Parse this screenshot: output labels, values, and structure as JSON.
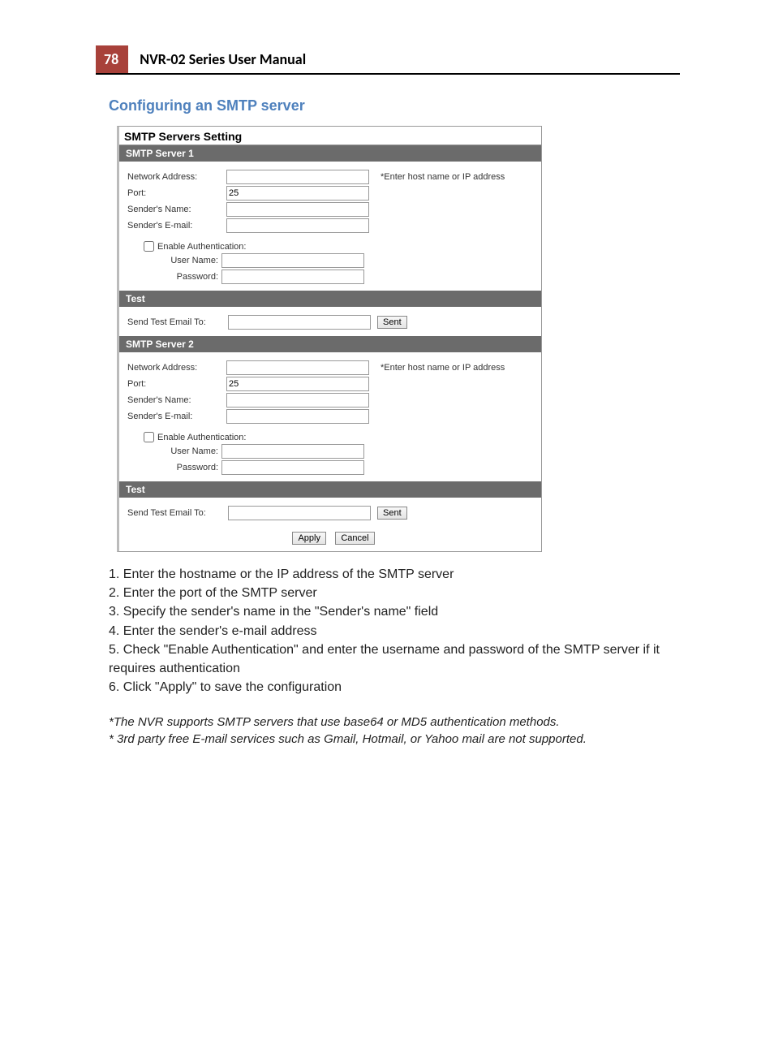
{
  "header": {
    "page_number": "78",
    "manual_title": "NVR-02 Series User Manual"
  },
  "section_heading": "Configuring an SMTP server",
  "panel": {
    "title": "SMTP Servers Setting",
    "servers": [
      {
        "bar_label": "SMTP Server 1",
        "labels": {
          "network_address": "Network Address:",
          "port": "Port:",
          "senders_name": "Sender's Name:",
          "senders_email": "Sender's E-mail:",
          "enable_authentication": "Enable Authentication:",
          "user_name": "User Name:",
          "password": "Password:"
        },
        "values": {
          "network_address": "",
          "port": "25",
          "senders_name": "",
          "senders_email": "",
          "enable_authentication": false,
          "user_name": "",
          "password": ""
        },
        "hint": "*Enter host name or IP address",
        "test": {
          "bar_label": "Test",
          "label": "Send Test Email To:",
          "value": "",
          "button": "Sent"
        }
      },
      {
        "bar_label": "SMTP Server 2",
        "labels": {
          "network_address": "Network Address:",
          "port": "Port:",
          "senders_name": "Sender's Name:",
          "senders_email": "Sender's E-mail:",
          "enable_authentication": "Enable Authentication:",
          "user_name": "User Name:",
          "password": "Password:"
        },
        "values": {
          "network_address": "",
          "port": "25",
          "senders_name": "",
          "senders_email": "",
          "enable_authentication": false,
          "user_name": "",
          "password": ""
        },
        "hint": "*Enter host name or IP address",
        "test": {
          "bar_label": "Test",
          "label": "Send Test Email To:",
          "value": "",
          "button": "Sent"
        }
      }
    ],
    "buttons": {
      "apply": "Apply",
      "cancel": "Cancel"
    }
  },
  "steps": [
    "1. Enter the hostname or the IP address of the SMTP server",
    "2. Enter the port of the SMTP server",
    "3. Specify the sender's name in the \"Sender's name\" field",
    "4. Enter the sender's e-mail address",
    "5. Check \"Enable Authentication\" and enter the username and password of the SMTP server if it requires authentication",
    "6. Click \"Apply\" to save the configuration"
  ],
  "notes": [
    "*The NVR supports SMTP servers that use base64 or MD5 authentication methods.",
    "* 3rd party free E-mail services such as Gmail, Hotmail, or Yahoo mail are not supported."
  ]
}
